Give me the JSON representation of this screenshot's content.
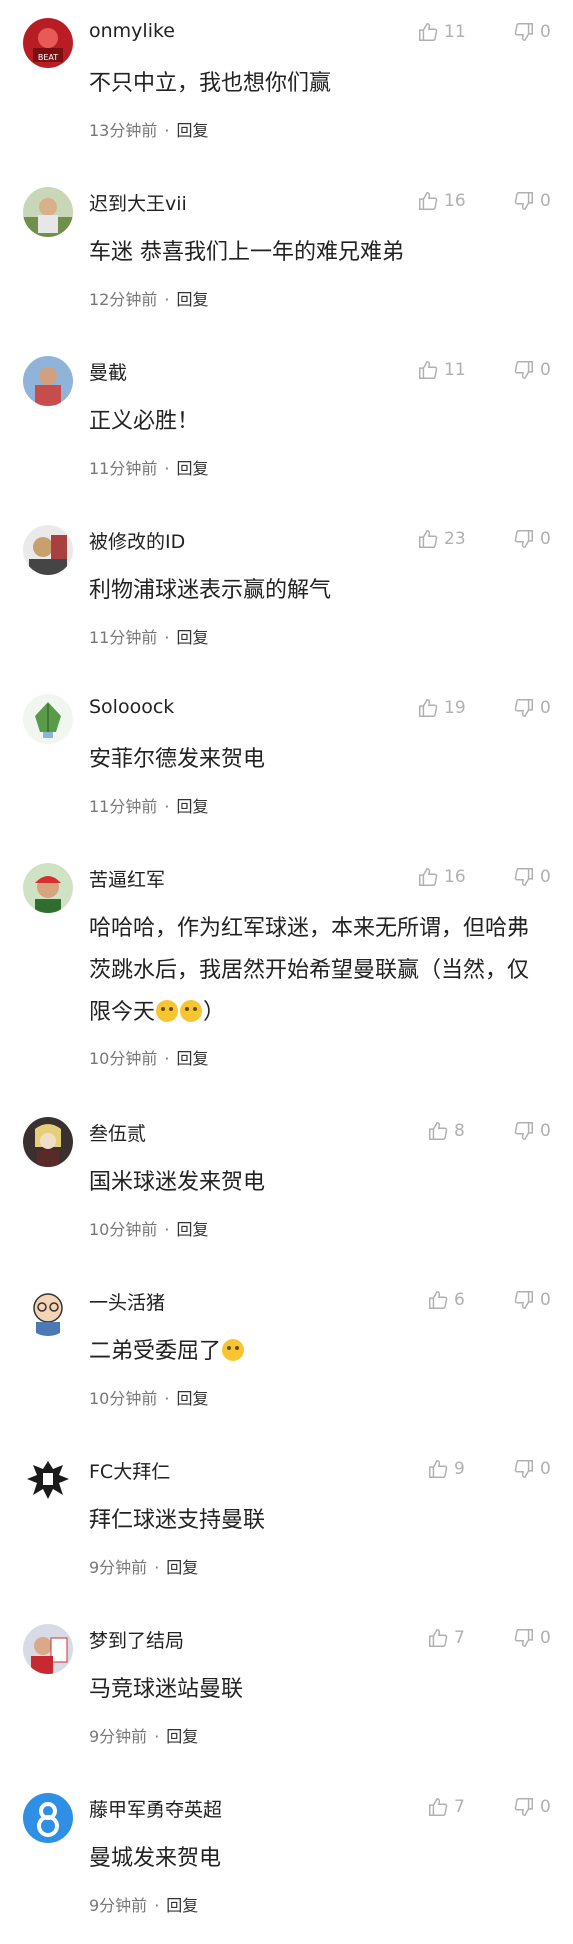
{
  "comments": [
    {
      "user": "onmylike",
      "text": "不只中立，我也想你们赢",
      "time": "13分钟前",
      "likes": "11",
      "dislikes": "0"
    },
    {
      "user": "迟到大王vii",
      "text": "车迷 恭喜我们上一年的难兄难弟",
      "time": "12分钟前",
      "likes": "16",
      "dislikes": "0"
    },
    {
      "user": "曼截",
      "text": "正义必胜！",
      "time": "11分钟前",
      "likes": "11",
      "dislikes": "0"
    },
    {
      "user": "被修改的ID",
      "text": "利物浦球迷表示赢的解气",
      "time": "11分钟前",
      "likes": "23",
      "dislikes": "0"
    },
    {
      "user": "Solooock",
      "text": "安菲尔德发来贺电",
      "time": "11分钟前",
      "likes": "19",
      "dislikes": "0"
    },
    {
      "user": "苦逼红军",
      "text": "哈哈哈，作为红军球迷，本来无所谓，但哈弗茨跳水后，我居然开始希望曼联赢（当然，仅限今天",
      "text_tail": "）",
      "time": "10分钟前",
      "likes": "16",
      "dislikes": "0"
    },
    {
      "user": "叁伍贰",
      "text": "国米球迷发来贺电",
      "time": "10分钟前",
      "likes": "8",
      "dislikes": "0"
    },
    {
      "user": "一头活猪",
      "text": "二弟受委屈了",
      "time": "10分钟前",
      "likes": "6",
      "dislikes": "0"
    },
    {
      "user": "FC大拜仁",
      "text": "拜仁球迷支持曼联",
      "time": "9分钟前",
      "likes": "9",
      "dislikes": "0"
    },
    {
      "user": "梦到了结局",
      "text": "马竞球迷站曼联",
      "time": "9分钟前",
      "likes": "7",
      "dislikes": "0"
    },
    {
      "user": "藤甲军勇夺英超",
      "text": "曼城发来贺电",
      "time": "9分钟前",
      "likes": "7",
      "dislikes": "0"
    }
  ],
  "labels": {
    "reply": "回复",
    "separator": "·"
  },
  "icons": {
    "like": "thumb-up-icon",
    "dislike": "thumb-down-icon"
  },
  "colors": {
    "text": "#222222",
    "meta": "#777777",
    "icon": "#b0b0b0"
  }
}
